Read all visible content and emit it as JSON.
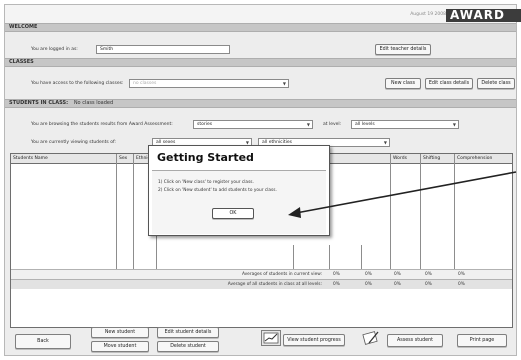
{
  "header": {
    "date": "August 19 2008",
    "logo": "AWARD"
  },
  "welcome": {
    "section_title": "WELCOME",
    "logged_in_label": "You are logged in as:",
    "user": "Smith",
    "edit_teacher_button": "Edit teacher details"
  },
  "classes": {
    "section_title": "CLASSES",
    "access_label": "You have access to the following classes:",
    "class_select": "no classes",
    "new_class_button": "New class",
    "edit_class_button": "Edit class details",
    "delete_class_button": "Delete class"
  },
  "students": {
    "section_title": "STUDENTS IN CLASS:",
    "section_status": "No class loaded",
    "browse_label": "You are browsing the students results from Award Assessment:",
    "assessment_select": "stories",
    "level_label": "at level:",
    "level_select": "all levels",
    "viewing_label": "You are currently viewing students of:",
    "sex_select": "all sexes",
    "ethnicity_select": "all ethnicities"
  },
  "table": {
    "columns": [
      "Students Name",
      "Sex",
      "Ethnicity",
      "Words",
      "Shifting",
      "Comprehension"
    ],
    "avg_current_label": "Averages of students in current view:",
    "avg_all_label": "Average of all students in class at all levels:",
    "avg_current_values": [
      "0%",
      "0%",
      "0%",
      "0%",
      "0%"
    ],
    "avg_all_values": [
      "0%",
      "0%",
      "0%",
      "0%",
      "0%"
    ]
  },
  "footer": {
    "back_button": "Back",
    "new_student_button": "New student",
    "move_student_button": "Move student",
    "edit_student_button": "Edit student details",
    "delete_student_button": "Delete student",
    "view_progress_button": "View student progress",
    "assess_student_button": "Assess student",
    "print_button": "Print page"
  },
  "dialog": {
    "title": "Getting Started",
    "line1": "1) Click on 'New class' to register your class.",
    "line2": "2) Click on 'New student' to add students to your class.",
    "ok_button": "OK"
  },
  "icons": [
    "progress-chart-icon",
    "assess-pencil-icon",
    "dropdown-arrow-icon"
  ]
}
